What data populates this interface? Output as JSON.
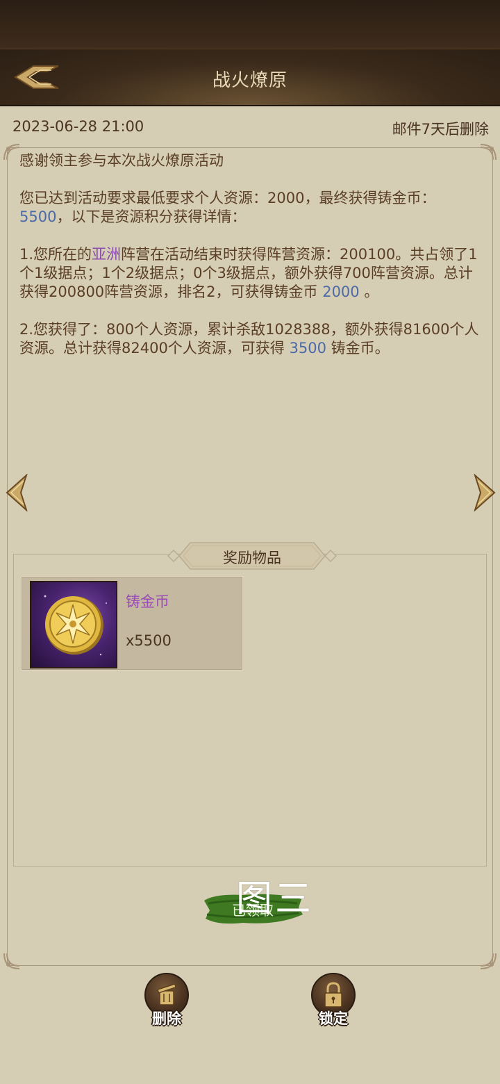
{
  "header": {
    "title": "战火燎原"
  },
  "mail": {
    "date": "2023-06-28 21:00",
    "expire_note": "邮件7天后删除",
    "greeting": "感谢领主参与本次战火燎原活动",
    "p1_a": "您已达到活动要求最低要求个人资源：2000，最终获得铸金币：",
    "p1_value": "5500",
    "p1_b": "，以下是资源积分获得详情：",
    "p2_a": "1.您所在的",
    "p2_faction": "亚洲",
    "p2_b": "阵营在活动结束时获得阵营资源：200100。共占领了1个1级据点；1个2级据点；0个3级据点，额外获得700阵营资源。总计获得200800阵营资源，排名2，可获得铸金币 ",
    "p2_value": "2000",
    "p2_c": " 。",
    "p3_a": "2.您获得了：800个人资源，累计杀敌1028388，额外获得81600个人资源。总计获得82400个人资源，可获得 ",
    "p3_value": "3500",
    "p3_b": " 铸金币。"
  },
  "rewards": {
    "section_label": "奖励物品",
    "items": [
      {
        "name": "铸金币",
        "count": "x5500",
        "icon": "gold-coin-icon"
      }
    ],
    "claimed_label": "已领取"
  },
  "watermark": "图三",
  "actions": {
    "delete_label": "删除",
    "lock_label": "锁定"
  },
  "colors": {
    "background": "#d6cdb5",
    "header": "#3a2a1a",
    "text": "#5a3e26",
    "value_blue": "#4a6aa8",
    "item_purple": "#9a4ab8",
    "claimed_green": "#3f7a22"
  }
}
